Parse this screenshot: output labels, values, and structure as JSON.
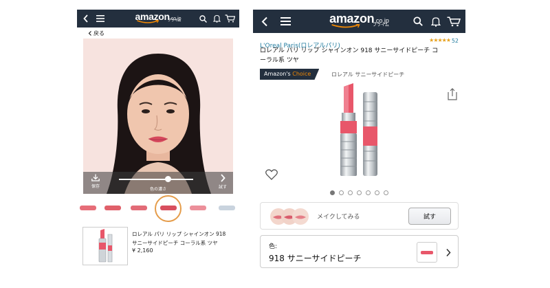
{
  "left": {
    "header": {
      "logo_word": "amazon",
      "logo_tld": ".co.jp",
      "logo_sub": "プライム"
    },
    "back_label": "戻る",
    "photo_bar": {
      "save_label": "保存",
      "slider_label": "色の濃さ",
      "slider_level": 0.66,
      "try_label": "試す"
    },
    "swatch_colors": [
      "#e66d78",
      "#e0606a",
      "#e26b77",
      "#d84f5e",
      "#ec8f9a",
      "#c9d3de"
    ],
    "selected_swatch": 3,
    "product": {
      "title_line1": "ロレアル パリ リップ シャインオン 918",
      "title_line2": "サニーサイドピーチ コーラル系 ツヤ",
      "price": "¥ 2,160"
    }
  },
  "right": {
    "header": {
      "logo_word": "amazon",
      "logo_tld": ".co.jp",
      "logo_sub": "プライム"
    },
    "brand": "L'Oreal Paris(ロレアルパリ)",
    "stars": "★★★★★",
    "rating_value": 4.5,
    "rating_count": "52",
    "title_line1": "ロレアル パリ リップ シャインオン 918 サニーサイドピーチ コ",
    "title_line2": "ーラル系 ツヤ",
    "choice_prefix": "Amazon's",
    "choice_accent": "Choice",
    "choice_sub": "ロレアル サニーサイドピーチ",
    "dot_count": 7,
    "active_dot": 0,
    "makeup_label": "メイクしてみる",
    "try_label": "試す",
    "color_key": "色:",
    "color_value": "918 サニーサイドピーチ"
  },
  "colors": {
    "nav_bg": "#232f3e",
    "accent_orange": "#f08804",
    "link_blue": "#1f7a9e",
    "lipstick": "#e8576a"
  }
}
